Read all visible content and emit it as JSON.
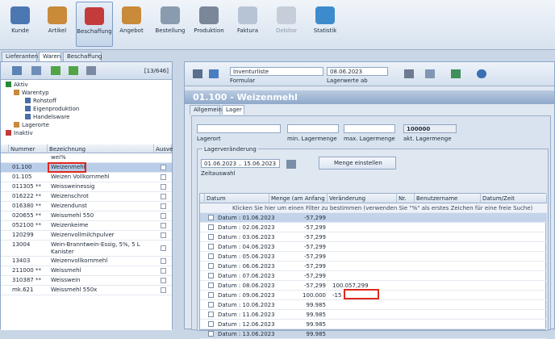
{
  "toolbar": {
    "items": [
      {
        "label": "Kunde",
        "icon": "customer-icon"
      },
      {
        "label": "Artikel",
        "icon": "article-icon"
      },
      {
        "label": "Beschaffung",
        "icon": "procurement-icon"
      },
      {
        "label": "Angebot",
        "icon": "offer-icon"
      },
      {
        "label": "Bestellung",
        "icon": "order-icon"
      },
      {
        "label": "Produktion",
        "icon": "production-icon"
      },
      {
        "label": "Faktura",
        "icon": "invoice-icon"
      },
      {
        "label": "Debitor",
        "icon": "debtor-icon"
      },
      {
        "label": "Statistik",
        "icon": "statistics-icon"
      }
    ],
    "active": "Beschaffung",
    "disabled": "Debitor"
  },
  "tabs": [
    "Lieferanten",
    "Waren",
    "Beschaffung"
  ],
  "left": {
    "count": "[13/646]",
    "tree": [
      "Aktiv",
      "Warentyp",
      "Rohstoff",
      "Eigenproduktion",
      "Handelsware",
      "Lagerorte",
      "Inaktiv"
    ],
    "columns": [
      "Nummer",
      "Bezeichnung",
      "Ausve"
    ],
    "filter": "wei%",
    "rows": [
      {
        "nr": "01.100",
        "bez": "Weizenmehl"
      },
      {
        "nr": "01.105",
        "bez": "Weizen Vollkornmehl"
      },
      {
        "nr": "011305 **",
        "bez": "Weissweinessig"
      },
      {
        "nr": "016222 **",
        "bez": "Weizenschrot"
      },
      {
        "nr": "016380 **",
        "bez": "Weizendunst"
      },
      {
        "nr": "020655 **",
        "bez": "Weissmehl 550"
      },
      {
        "nr": "052100 **",
        "bez": "Weizenkeime"
      },
      {
        "nr": "120299",
        "bez": "Weizenvollmilchpulver"
      },
      {
        "nr": "13004",
        "bez": "Wein-Branntwein-Essig, 5%, 5 L Kanister"
      },
      {
        "nr": "13403",
        "bez": "Weizenvollkornmehl"
      },
      {
        "nr": "211000 **",
        "bez": "Weissmehl"
      },
      {
        "nr": "310387 **",
        "bez": "Weisswein"
      },
      {
        "nr": "mk.621",
        "bez": "Weissmehl 550x"
      }
    ]
  },
  "right": {
    "formular_value": "Inventurliste",
    "formular_label": "Formular",
    "date_value": "08.06.2023",
    "date_label": "Lagerwerte ab",
    "title": "01.100 - Weizenmehl",
    "subtabs": [
      "Allgemein",
      "Lager"
    ],
    "lagerort_label": "Lagerort",
    "min_label": "min. Lagermenge",
    "max_label": "max. Lagermenge",
    "akt_value": "100000",
    "akt_label": "akt. Lagermenge",
    "group_label": "Lagerveränderung",
    "zeitraum_value": "01.06.2023 .. 15.06.2023",
    "zeitraum_label": "Zeitauswahl",
    "set_button": "Menge einstellen",
    "columns": [
      "Datum",
      "Menge (am Anfang de",
      "Veränderung",
      "Nr.",
      "Benutzername",
      "Datum/Zeit"
    ],
    "hint": "Klicken Sie hier um einen Filter zu bestimmen (verwenden Sie \"%\" als erstes Zeichen für eine freie Suche)",
    "rows": [
      {
        "datum": "Datum : 01.06.2023",
        "menge": "-57,299",
        "ver": ""
      },
      {
        "datum": "Datum : 02.06.2023",
        "menge": "-57,299",
        "ver": ""
      },
      {
        "datum": "Datum : 03.06.2023",
        "menge": "-57,299",
        "ver": ""
      },
      {
        "datum": "Datum : 04.06.2023",
        "menge": "-57,299",
        "ver": ""
      },
      {
        "datum": "Datum : 05.06.2023",
        "menge": "-57,299",
        "ver": ""
      },
      {
        "datum": "Datum : 06.06.2023",
        "menge": "-57,299",
        "ver": ""
      },
      {
        "datum": "Datum : 07.06.2023",
        "menge": "-57,299",
        "ver": ""
      },
      {
        "datum": "Datum : 08.06.2023",
        "menge": "-57,299",
        "ver": "100.057,299"
      },
      {
        "datum": "Datum : 09.06.2023",
        "menge": "100.000",
        "ver": "-15"
      },
      {
        "datum": "Datum : 10.06.2023",
        "menge": "99.985",
        "ver": ""
      },
      {
        "datum": "Datum : 11.06.2023",
        "menge": "99.985",
        "ver": ""
      },
      {
        "datum": "Datum : 12.06.2023",
        "menge": "99.985",
        "ver": ""
      },
      {
        "datum": "Datum : 13.06.2023",
        "menge": "99.985",
        "ver": ""
      }
    ]
  }
}
